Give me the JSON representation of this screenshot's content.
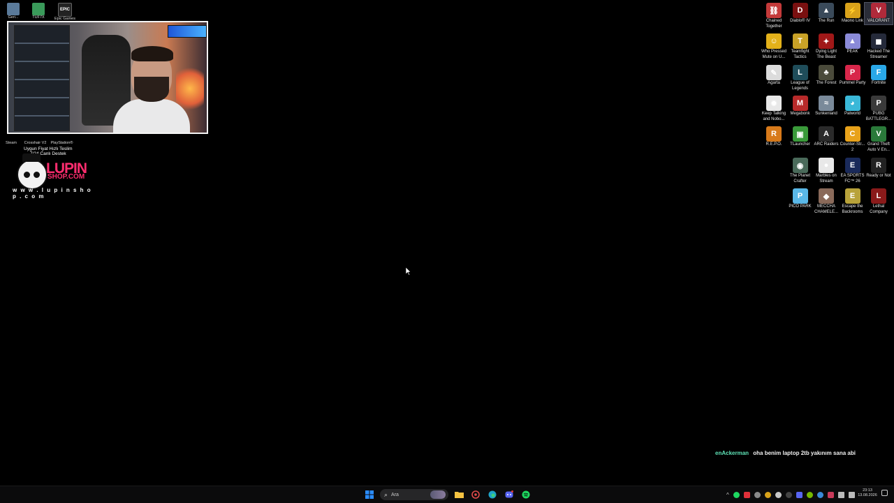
{
  "desktop_icons_right": [
    {
      "label": "Chained Together",
      "color": "#c43a3a",
      "glyph": "⛓",
      "col": 0,
      "row": 0
    },
    {
      "label": "Diablo® IV",
      "color": "#7a1010",
      "glyph": "D",
      "col": 1,
      "row": 0
    },
    {
      "label": "The Run",
      "color": "#3a4a5a",
      "glyph": "▲",
      "col": 2,
      "row": 0
    },
    {
      "label": "Maono Link",
      "color": "#d9a21a",
      "glyph": "⚡",
      "col": 3,
      "row": 0
    },
    {
      "label": "VALORANT",
      "color": "#b02a3a",
      "glyph": "V",
      "col": 4,
      "row": 0,
      "selected": true
    },
    {
      "label": "Who Pressed Mute on U...",
      "color": "#e3b11a",
      "glyph": "☺",
      "col": 0,
      "row": 1
    },
    {
      "label": "Teamfight Tactics",
      "color": "#c9a227",
      "glyph": "T",
      "col": 1,
      "row": 1
    },
    {
      "label": "Dying Light The Beast",
      "color": "#a01818",
      "glyph": "✦",
      "col": 2,
      "row": 1
    },
    {
      "label": "PEAK",
      "color": "#8a8ad8",
      "glyph": "▲",
      "col": 3,
      "row": 1
    },
    {
      "label": "Hacked The Streamer",
      "color": "#252a3a",
      "glyph": "◼",
      "col": 4,
      "row": 1
    },
    {
      "label": "Agarta",
      "color": "#dcdcdc",
      "glyph": "✎",
      "col": 0,
      "row": 2
    },
    {
      "label": "League of Legends",
      "color": "#1f4d5a",
      "glyph": "L",
      "col": 1,
      "row": 2
    },
    {
      "label": "The Forest",
      "color": "#4a4a3a",
      "glyph": "♣",
      "col": 2,
      "row": 2
    },
    {
      "label": "Pummel Party",
      "color": "#d8264a",
      "glyph": "P",
      "col": 3,
      "row": 2
    },
    {
      "label": "Fortnite",
      "color": "#2aa8e8",
      "glyph": "F",
      "col": 4,
      "row": 2
    },
    {
      "label": "Keep Talking and Nobo...",
      "color": "#e8e8e8",
      "glyph": "✹",
      "col": 0,
      "row": 3
    },
    {
      "label": "Megabonk",
      "color": "#b82a2a",
      "glyph": "M",
      "col": 1,
      "row": 3
    },
    {
      "label": "Sunkenland",
      "color": "#7a8a9a",
      "glyph": "≈",
      "col": 2,
      "row": 3
    },
    {
      "label": "Palworld",
      "color": "#3ab8d8",
      "glyph": "◕",
      "col": 3,
      "row": 3
    },
    {
      "label": "PUBG BATTLEGR...",
      "color": "#3a3a3a",
      "glyph": "P",
      "col": 4,
      "row": 3
    },
    {
      "label": "R.E.P.O.",
      "color": "#d87a1a",
      "glyph": "R",
      "col": 0,
      "row": 4
    },
    {
      "label": "TLauncher",
      "color": "#3a9a3a",
      "glyph": "▣",
      "col": 1,
      "row": 4
    },
    {
      "label": "ARC Raiders",
      "color": "#2a2a2a",
      "glyph": "A",
      "col": 2,
      "row": 4
    },
    {
      "label": "Counter-Str... 2",
      "color": "#e8a21a",
      "glyph": "C",
      "col": 3,
      "row": 4
    },
    {
      "label": "Grand Theft Auto V En...",
      "color": "#2a7a3a",
      "glyph": "V",
      "col": 4,
      "row": 4
    },
    {
      "label": "The Planet Crafter",
      "color": "#4a6a5a",
      "glyph": "◉",
      "col": 1,
      "row": 5
    },
    {
      "label": "Marbles on Stream",
      "color": "#e8e8e8",
      "glyph": "●",
      "col": 2,
      "row": 5
    },
    {
      "label": "EA SPORTS FC™ 26",
      "color": "#1a2a5a",
      "glyph": "E",
      "col": 3,
      "row": 5
    },
    {
      "label": "Ready or Not",
      "color": "#222",
      "glyph": "R",
      "col": 4,
      "row": 5
    },
    {
      "label": "PICO PARK",
      "color": "#5ab8e8",
      "glyph": "P",
      "col": 1,
      "row": 6
    },
    {
      "label": "MECCHA CHAMELE...",
      "color": "#8a6a5a",
      "glyph": "◆",
      "col": 2,
      "row": 6
    },
    {
      "label": "Escape the Backrooms",
      "color": "#b8a23a",
      "glyph": "E",
      "col": 3,
      "row": 6
    },
    {
      "label": "Lethal Company",
      "color": "#8a1a1a",
      "glyph": "L",
      "col": 4,
      "row": 6
    }
  ],
  "desktop_icons_left": [
    {
      "label": "Geri...",
      "color": "#5a7a9a"
    },
    {
      "label": "TUF7X",
      "color": "#3a9a5a"
    },
    {
      "label": "Epic Games",
      "color": "#222"
    }
  ],
  "left_strip_labels": {
    "steam": "Steam",
    "crosshair": "Crosshair V2",
    "playstation": "PlayStation®",
    "promo_line1": "Uygun Fiyat Hızlı Teslim",
    "promo_line2": "7/24 Canlı Destek"
  },
  "logo": {
    "brand": "LUPIN",
    "brand2": "SHOP.COM",
    "url": "w w w . l u p i n s h o p . c o m"
  },
  "chat": {
    "username": "enAckerman",
    "message": "oha benim laptop 2tb yakınım sana abi"
  },
  "taskbar": {
    "search_placeholder": "Ara",
    "clock_time": "23:13",
    "clock_date": "13.08.2026"
  },
  "colors": {
    "chat_user": "#5fe3b7",
    "brand": "#ff2d6f",
    "windows_blue": "#2a8cff"
  }
}
